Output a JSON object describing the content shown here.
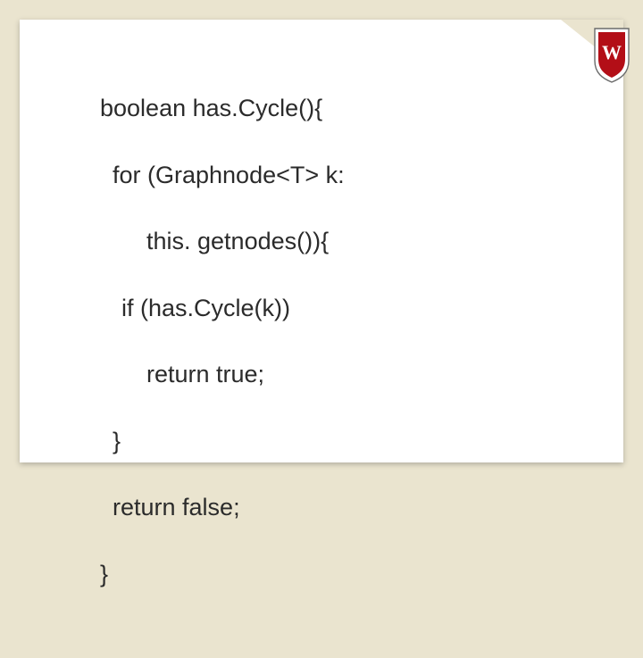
{
  "crest": {
    "letter": "W",
    "bg": "#b30e17",
    "shield": "#ffffff",
    "outline": "#5a5a5a"
  },
  "code": {
    "l1": "boolean has.Cycle(){",
    "l2": "for (Graphnode<T> k:",
    "l3": "this. getnodes()){",
    "l4": "if (has.Cycle(k))",
    "l5": "return true;",
    "l6": "}",
    "l7": "return false;",
    "l8": "}"
  }
}
